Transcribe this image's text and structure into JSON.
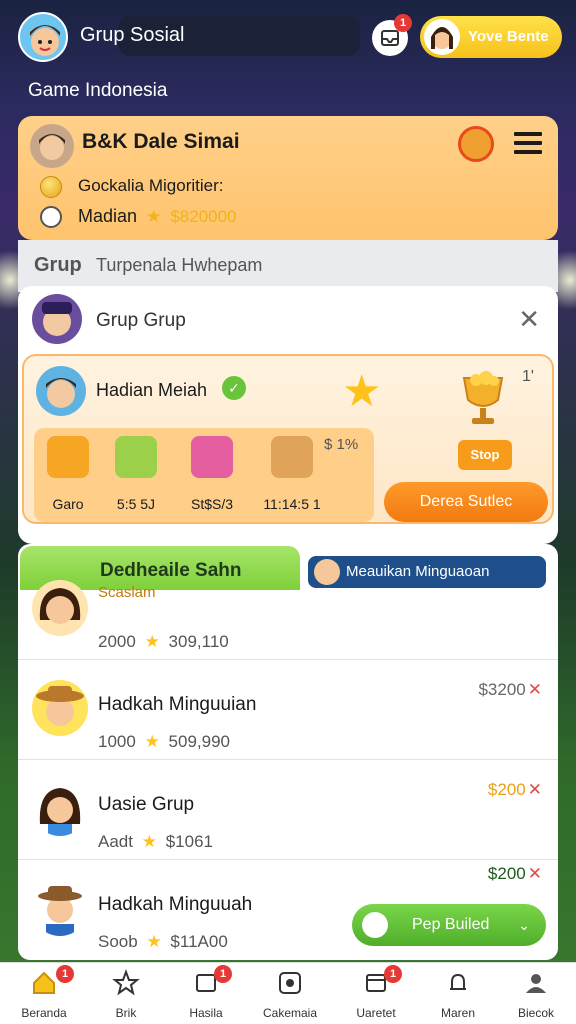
{
  "topbar": {
    "title": "Grup Sosial",
    "notification_count": "1",
    "user_pill_label": "Yove Bente"
  },
  "location": "Game Indonesia",
  "profile": {
    "name": "B&K Dale Simai",
    "line1": "Gockalia Migoritier:",
    "line2_label": "Madian",
    "line2_points": "$820000"
  },
  "group_section": {
    "label": "Grup",
    "sub": "Turpenala Hwhepam"
  },
  "group_panel": {
    "title": "Grup Grup",
    "reward": {
      "title": "Hadian Meiah",
      "count": "1'",
      "items": [
        {
          "label": "Garo",
          "icon": "gift-box-icon",
          "color": "#f6a623"
        },
        {
          "label": "5:5 5J",
          "icon": "present-icon",
          "color": "#9bd14a"
        },
        {
          "label": "St$S/3",
          "icon": "candy-icon",
          "color": "#e55fa0"
        },
        {
          "label": "11:14:5 1",
          "icon": "house-icon",
          "color": "#e0a35a"
        }
      ],
      "percent": "$ 1%",
      "stop_label": "Stop",
      "claim_label": "Derea Sutlec"
    }
  },
  "leaderboard": {
    "tab_label": "Dedheaile Sahn",
    "tab_sub": "Scaslam",
    "weekly_label": "Meauikan Minguaoan",
    "rows": [
      {
        "name": "Dedheaile Sahn",
        "level": "2000",
        "score": "309,110",
        "prize": "",
        "prize_color": "#000"
      },
      {
        "name": "Hadkah Minguuian",
        "level": "1000",
        "score": "509,990",
        "prize": "$3200",
        "prize_color": "#666"
      },
      {
        "name": "Uasie Grup",
        "level": "Aadt",
        "score": "$1061",
        "prize": "$200",
        "prize_color": "#e8a21a"
      },
      {
        "name": "Hadkah Minguuah",
        "level": "Soob",
        "score": "$11A00",
        "prize": "$200",
        "prize_color": "#1f5a1f"
      }
    ],
    "follow_label": "Pep Builed"
  },
  "bottom_nav": {
    "items": [
      {
        "label": "Beranda",
        "icon": "home-icon",
        "badge": "1"
      },
      {
        "label": "Brik",
        "icon": "star-icon",
        "badge": ""
      },
      {
        "label": "Hasila",
        "icon": "inbox-icon",
        "badge": "1"
      },
      {
        "label": "Cakemaia",
        "icon": "game-icon",
        "badge": ""
      },
      {
        "label": "Uaretet",
        "icon": "calendar-icon",
        "badge": "1"
      },
      {
        "label": "Maren",
        "icon": "bell-icon",
        "badge": ""
      },
      {
        "label": "Biecok",
        "icon": "profile-icon",
        "badge": ""
      }
    ]
  },
  "colors": {
    "accent_orange": "#f79b1a",
    "accent_green": "#7fd03a",
    "accent_blue": "#1e4f8a",
    "accent_yellow": "#ffc21a"
  }
}
